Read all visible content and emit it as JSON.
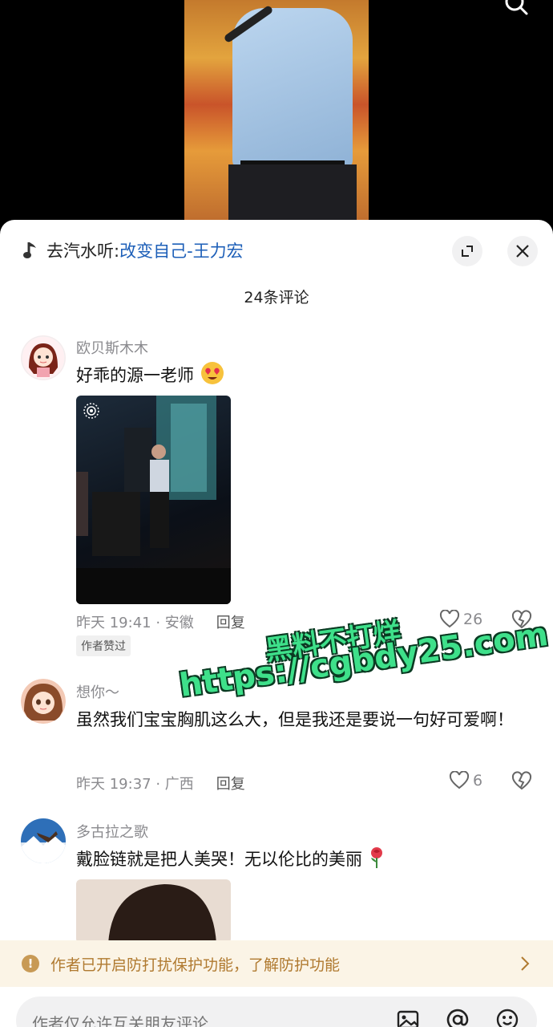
{
  "music": {
    "prefix": "去汽水听:",
    "song": "改变自己-王力宏"
  },
  "comment_count": "24条评论",
  "comments": [
    {
      "user": "欧贝斯木木",
      "text": "好乖的源一老师",
      "meta": "昨天 19:41 · 安徽",
      "reply": "回复",
      "likes": "26",
      "badge": "作者赞过"
    },
    {
      "user": "想你～",
      "text": "虽然我们宝宝胸肌这么大，但是我还是要说一句好可爱啊！",
      "meta": "昨天 19:37 · 广西",
      "reply": "回复",
      "likes": "6"
    },
    {
      "user": "多古拉之歌",
      "text": "戴脸链就是把人美哭！无以伦比的美丽"
    }
  ],
  "watermark": {
    "line1": "黑料不打烊",
    "line2": "https://cgbdy25.com"
  },
  "notice": "作者已开启防打扰保护功能，了解防护功能",
  "input_placeholder": "作者仅允许互关朋友评论",
  "colors": {
    "link": "#1d5fb8",
    "notice_bg": "#fbf4e6",
    "notice_text": "#b07a30",
    "watermark": "#3ee08a"
  }
}
